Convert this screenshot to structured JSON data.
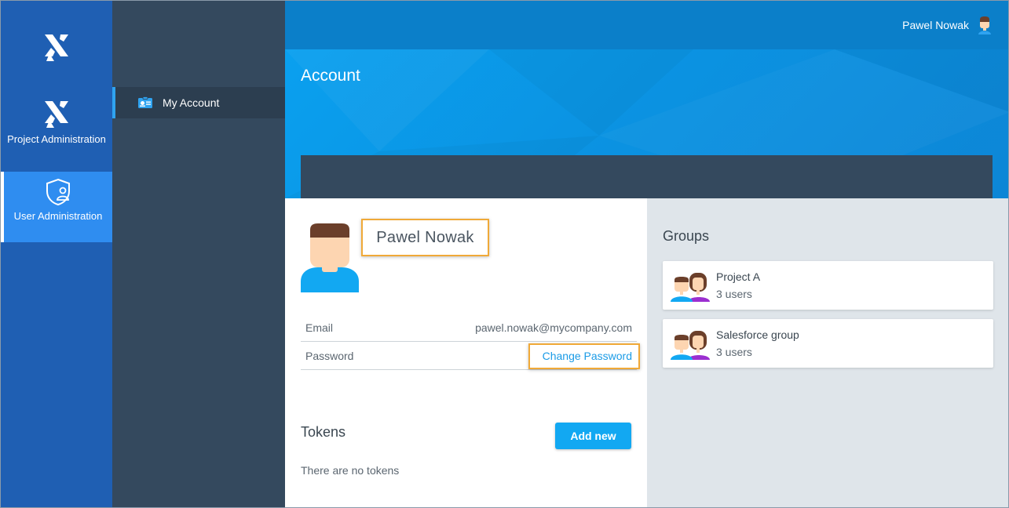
{
  "header": {
    "user_name": "Pawel Nowak"
  },
  "rail": {
    "items": [
      {
        "label": "Project Administration",
        "icon": "x-logo-icon"
      },
      {
        "label": "User Administration",
        "icon": "shield-user-icon"
      }
    ]
  },
  "subnav": {
    "items": [
      {
        "label": "My Account",
        "icon": "id-card-icon"
      }
    ]
  },
  "page": {
    "title": "Account"
  },
  "profile": {
    "name": "Pawel Nowak",
    "email_label": "Email",
    "email_value": "pawel.nowak@mycompany.com",
    "password_label": "Password",
    "change_password_label": "Change Password"
  },
  "tokens": {
    "title": "Tokens",
    "add_label": "Add new",
    "empty_text": "There are no tokens"
  },
  "groups": {
    "title": "Groups",
    "items": [
      {
        "name": "Project A",
        "count": "3 users"
      },
      {
        "name": "Salesforce group",
        "count": "3 users"
      }
    ]
  },
  "colors": {
    "rail": "#1f5fb3",
    "rail_active": "#2f8df0",
    "subnav": "#34495e",
    "topbar": "#0b7fc9",
    "hero": "#0a9aeb",
    "accent": "#12a8f2",
    "highlight": "#f0a938"
  }
}
